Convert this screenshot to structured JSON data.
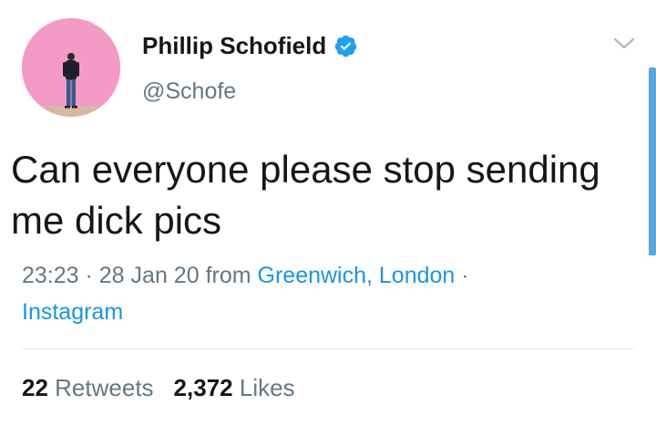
{
  "user": {
    "display_name": "Phillip Schofield",
    "handle": "@Schofe",
    "verified": true
  },
  "tweet": {
    "text": "Can everyone please stop sending me dick pics",
    "time": "23:23",
    "separator": " · ",
    "date": "28 Jan 20",
    "from_label": "from",
    "location": "Greenwich, London",
    "separator2": " ·",
    "source": "Instagram"
  },
  "stats": {
    "retweets_count": "22",
    "retweets_label": "Retweets",
    "likes_count": "2,372",
    "likes_label": "Likes"
  },
  "colors": {
    "accent": "#1b95e0",
    "verified_badge": "#1da1f2",
    "avatar_bg": "#f49ac6",
    "muted_text": "#657786"
  },
  "icons": {
    "verified": "verified-badge-icon",
    "menu": "chevron-down-icon"
  }
}
